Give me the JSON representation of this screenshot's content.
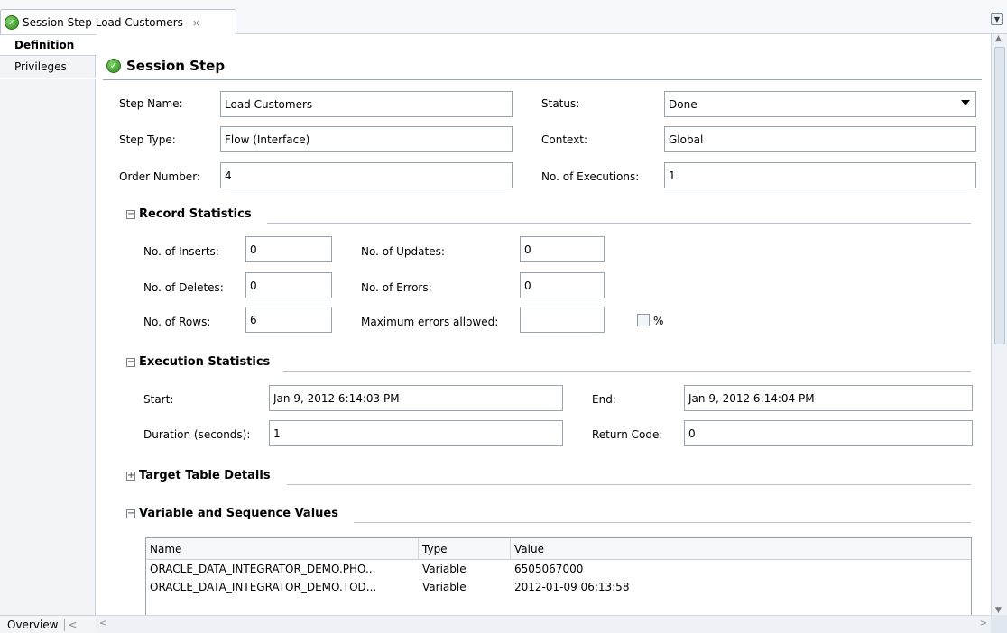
{
  "tab": {
    "title": "Session Step Load Customers",
    "close": "×"
  },
  "nav": {
    "items": [
      {
        "label": "Definition"
      },
      {
        "label": "Privileges"
      }
    ],
    "overview": "Overview"
  },
  "section": {
    "title": "Session Step"
  },
  "step": {
    "name_label": "Step Name:",
    "name_value": "Load Customers",
    "type_label": "Step Type:",
    "type_value": "Flow (Interface)",
    "order_label": "Order Number:",
    "order_value": "4",
    "status_label": "Status:",
    "status_value": "Done",
    "context_label": "Context:",
    "context_value": "Global",
    "executions_label": "No. of Executions:",
    "executions_value": "1"
  },
  "record_stats": {
    "title": "Record Statistics",
    "inserts_label": "No. of Inserts:",
    "inserts_value": "0",
    "deletes_label": "No. of Deletes:",
    "deletes_value": "0",
    "rows_label": "No. of Rows:",
    "rows_value": "6",
    "updates_label": "No. of Updates:",
    "updates_value": "0",
    "errors_label": "No. of Errors:",
    "errors_value": "0",
    "max_errors_label": "Maximum errors allowed:",
    "max_errors_value": "",
    "percent_label": "%"
  },
  "exec_stats": {
    "title": "Execution Statistics",
    "start_label": "Start:",
    "start_value": "Jan 9, 2012 6:14:03 PM",
    "duration_label": "Duration (seconds):",
    "duration_value": "1",
    "end_label": "End:",
    "end_value": "Jan 9, 2012 6:14:04 PM",
    "return_label": "Return Code:",
    "return_value": "0"
  },
  "target_table": {
    "title": "Target Table Details"
  },
  "variables": {
    "title": "Variable and Sequence Values",
    "columns": [
      "Name",
      "Type",
      "Value"
    ],
    "rows": [
      {
        "name": "ORACLE_DATA_INTEGRATOR_DEMO.PHO...",
        "type": "Variable",
        "value": "6505067000"
      },
      {
        "name": "ORACLE_DATA_INTEGRATOR_DEMO.TOD...",
        "type": "Variable",
        "value": "2012-01-09 06:13:58"
      }
    ]
  }
}
